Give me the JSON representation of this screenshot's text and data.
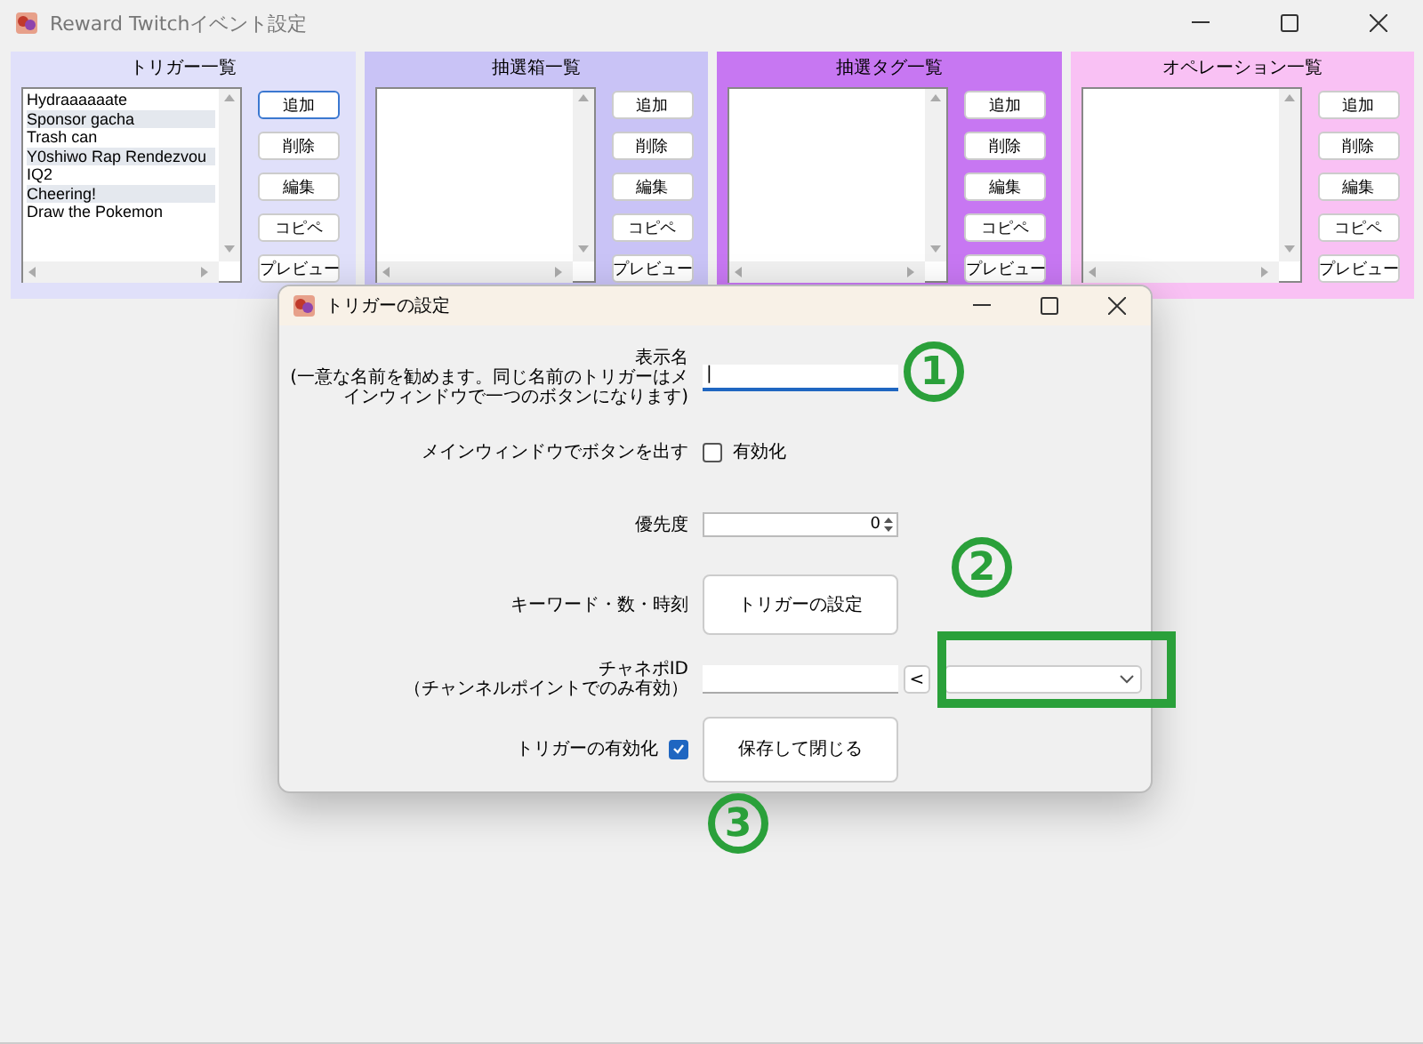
{
  "window": {
    "title": "Reward Twitchイベント設定"
  },
  "panels": [
    {
      "title": "トリガー一覧",
      "color": "#e0e0fa",
      "items": [
        "Hydraaaaaate",
        "Sponsor gacha",
        "Trash can",
        "Y0shiwo Rap Rendezvou",
        "IQ2",
        "Cheering!",
        "Draw the Pokemon"
      ],
      "buttons": [
        {
          "label": "追加",
          "focused": true
        },
        {
          "label": "削除",
          "focused": false
        },
        {
          "label": "編集",
          "focused": false
        },
        {
          "label": "コピペ",
          "focused": false
        },
        {
          "label": "プレビュー",
          "focused": false
        }
      ]
    },
    {
      "title": "抽選箱一覧",
      "color": "#c9c3f6",
      "buttons": [
        {
          "label": "追加",
          "focused": false
        },
        {
          "label": "削除",
          "focused": false
        },
        {
          "label": "編集",
          "focused": false
        },
        {
          "label": "コピペ",
          "focused": false
        },
        {
          "label": "プレビュー",
          "focused": false
        }
      ]
    },
    {
      "title": "抽選タグ一覧",
      "color": "#c777f2",
      "buttons": [
        {
          "label": "追加",
          "focused": false
        },
        {
          "label": "削除",
          "focused": false
        },
        {
          "label": "編集",
          "focused": false
        },
        {
          "label": "コピペ",
          "focused": false
        },
        {
          "label": "プレビュー",
          "focused": false
        }
      ]
    },
    {
      "title": "オペレーション一覧",
      "color": "#f9c1f4",
      "buttons": [
        {
          "label": "追加",
          "focused": false
        },
        {
          "label": "削除",
          "focused": false
        },
        {
          "label": "編集",
          "focused": false
        },
        {
          "label": "コピペ",
          "focused": false
        },
        {
          "label": "プレビュー",
          "focused": false
        }
      ]
    }
  ],
  "dialog": {
    "title": "トリガーの設定",
    "rows": [
      {
        "kind": "text",
        "label": "表示名",
        "note": "(一意な名前を勧めます。同じ名前のトリガーはメインウィンドウで一つのボタンになります)",
        "value": "|"
      },
      {
        "kind": "checkbox",
        "label": "メインウィンドウでボタンを出す",
        "option": "有効化",
        "checked": false
      },
      {
        "kind": "spin",
        "label": "優先度",
        "value": "0"
      },
      {
        "kind": "button",
        "label": "キーワード・数・時刻",
        "button": "トリガーの設定"
      },
      {
        "kind": "channel",
        "label": "チャネポID",
        "note": "（チャンネルポイントでのみ有効）",
        "arrow": "<"
      },
      {
        "kind": "save",
        "label": "トリガーの有効化",
        "checked": true,
        "button": "保存して閉じる"
      }
    ]
  },
  "annotations": [
    {
      "label": "1"
    },
    {
      "label": "2"
    },
    {
      "label": "3"
    }
  ]
}
